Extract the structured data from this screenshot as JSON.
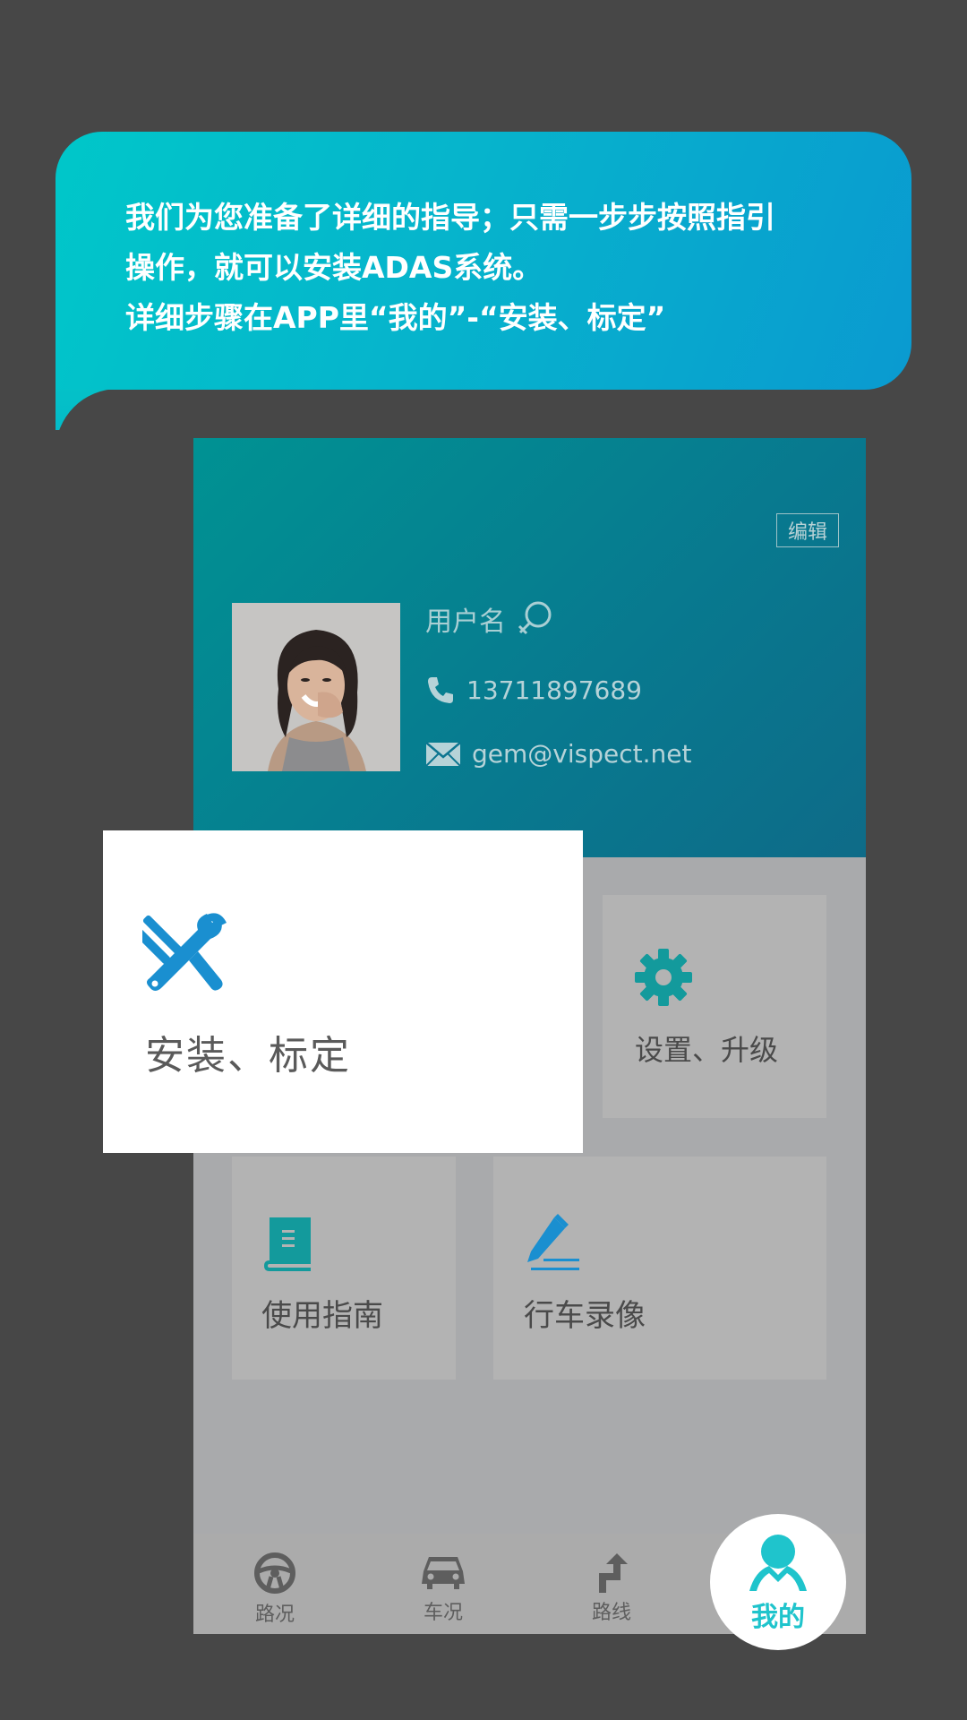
{
  "bubble": {
    "lines": [
      "我们为您准备了详细的指导；只需一步步按照指引",
      "操作，就可以安装ADAS系统。",
      "详细步骤在APP里“我的”-“安装、标定”"
    ]
  },
  "profile": {
    "edit_label": "编辑",
    "username": "用户名",
    "phone": "13711897689",
    "email": "gem@vispect.net"
  },
  "tiles": {
    "settings_label": "设置、升级",
    "guide_label": "使用指南",
    "recording_label": "行车录像"
  },
  "popup": {
    "label": "安装、标定"
  },
  "tabbar": {
    "road_label": "路况",
    "car_label": "车况",
    "route_label": "路线",
    "me_label": "我的"
  },
  "colors": {
    "accent": "#1fc4cc",
    "teal_icon": "#139a9c",
    "blue_icon": "#1a8fd0"
  }
}
